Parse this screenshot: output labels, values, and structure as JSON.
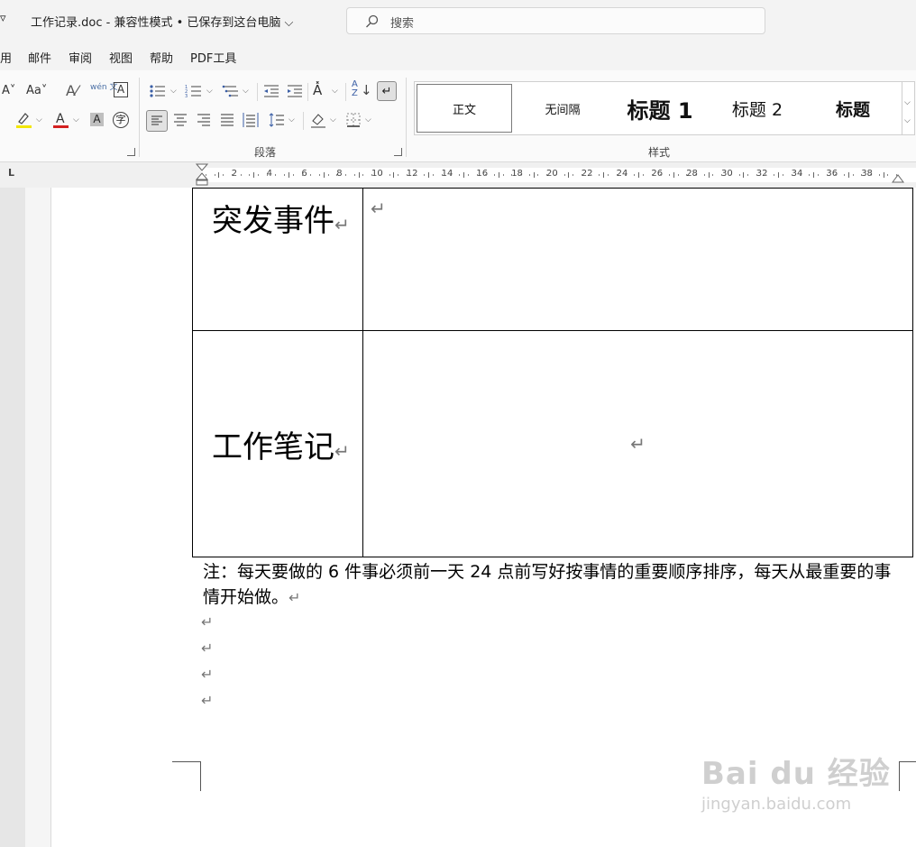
{
  "titlebar": {
    "quick_access_glyph": "▿",
    "doc_title": "工作记录.doc  -  兼容性模式 • 已保存到这台电脑",
    "title_dropdown_glyph": "⌵",
    "search_placeholder": "搜索"
  },
  "menu": [
    "用",
    "邮件",
    "审阅",
    "视图",
    "帮助",
    "PDF工具"
  ],
  "ribbon": {
    "font_row1": [
      "A˅",
      "Aa˅",
      "A⁄",
      "wén 文",
      "A"
    ],
    "paragraph_label": "段落",
    "styles_label": "样式",
    "styles": [
      {
        "label": "正文"
      },
      {
        "label": "无间隔"
      },
      {
        "label": "标题 1"
      },
      {
        "label": "标题 2"
      },
      {
        "label": "标题"
      }
    ]
  },
  "ruler": {
    "marker": "L",
    "ticks": [
      "2",
      "4",
      "6",
      "8",
      "10",
      "12",
      "14",
      "16",
      "18",
      "20",
      "22",
      "24",
      "26",
      "28",
      "30",
      "32",
      "34",
      "36",
      "38"
    ]
  },
  "document": {
    "row1_label": "突发事件",
    "row2_label": "工作笔记",
    "para_mark": "↵",
    "note": "注：每天要做的 6 件事必须前一天 24 点前写好按事情的重要顺序排序，每天从最重要的事情开始做。",
    "empty_paragraphs": 4
  },
  "watermark": {
    "brand": "Bai du 经验",
    "url": "jingyan.baidu.com"
  },
  "colors": {
    "highlight_yellow": "#f2e600",
    "font_red": "#d42020",
    "accent_gray": "#e6e6e6"
  }
}
